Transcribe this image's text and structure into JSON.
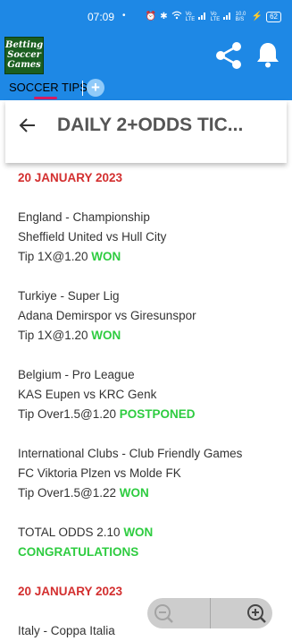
{
  "status": {
    "time": "07:09",
    "dot": "•",
    "icons": [
      "⏰",
      "✱",
      "wifi",
      "Vo LTE",
      "signal",
      "Vo LTE",
      "signal",
      "10.0 B/S",
      "⚡"
    ],
    "battery": "62"
  },
  "app": {
    "logo_text": "Betting Soccer Games",
    "colors": {
      "bar": "#1e88e5",
      "won": "#2ecc40",
      "date": "#d32f2f",
      "underline": "#d81b60"
    }
  },
  "tabs": {
    "active_label": "SOCCER TIPS",
    "add_label": "+"
  },
  "header": {
    "title": "DAILY 2+ODDS TIC..."
  },
  "content": {
    "date1": "20 JANUARY 2023",
    "matches": [
      {
        "league": "England - Championship",
        "teams": "Sheffield United vs Hull City",
        "tip": "Tip 1X@1.20",
        "result": "WON"
      },
      {
        "league": "Turkiye - Super Lig",
        "teams": "Adana Demirspor vs Giresunspor",
        "tip": "Tip 1X@1.20",
        "result": "WON"
      },
      {
        "league": "Belgium - Pro League",
        "teams": "KAS Eupen vs KRC Genk",
        "tip": "Tip Over1.5@1.20",
        "result": "POSTPONED"
      },
      {
        "league": "International Clubs - Club Friendly Games",
        "teams": "FC Viktoria Plzen vs Molde FK",
        "tip": "Tip Over1.5@1.22",
        "result": "WON"
      }
    ],
    "total": "TOTAL ODDS 2.10",
    "total_result": "WON",
    "congrats": "CONGRATULATIONS",
    "date2": "20 JANUARY 2023",
    "next_league": "Italy - Coppa Italia"
  },
  "zoom": {
    "out_icon": "zoom-out-icon",
    "in_icon": "zoom-in-icon"
  }
}
